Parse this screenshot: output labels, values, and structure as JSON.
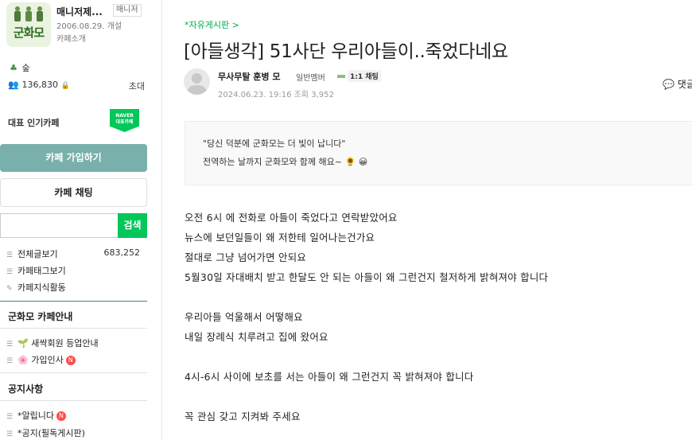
{
  "cafe": {
    "name": "매니저제...",
    "manager_badge": "매니저",
    "founded": "2006.08.29. 개설",
    "intro": "카페소개",
    "logo_text": "군화모",
    "level": "숲",
    "members": "136,830",
    "invite": "초대",
    "popular": "대표 인기카페",
    "naver_badge_top": "NAVER",
    "naver_badge_bottom": "대표카페"
  },
  "sidebar": {
    "join_label": "카페 가입하기",
    "chat_label": "카페 채팅",
    "search_placeholder": "",
    "search_label": "검색",
    "menu": [
      {
        "label": "전체글보기",
        "count": "683,252"
      },
      {
        "label": "카페태그보기"
      },
      {
        "label": "카페지식활동"
      }
    ],
    "section_guide": "군화모 카페안내",
    "guide_items": [
      {
        "label": "새싹회원 등업안내"
      },
      {
        "label": "가입인사"
      }
    ],
    "section_notice": "공지사항",
    "notice_items": [
      {
        "label": "*알립니다"
      },
      {
        "label": "*공지(필독게시판)"
      }
    ],
    "new_badge": "N"
  },
  "post": {
    "board": "*자유게시판 >",
    "title": "[아들생각] 51사단 우리아들이..죽었다네요",
    "author": "무사무탈 훈병 모",
    "member_level": "일반멤버",
    "chat_link": "1:1 채팅",
    "meta": "2024.06.23. 19:16   조회 3,952",
    "comment_link": "댓글",
    "quote_lines": [
      "\"당신 덕분에 군화모는 더 빛이 납니다\"",
      "전역하는 날까지 군화모와 함께 해요~ 🌻 😀"
    ],
    "body_lines": [
      "오전 6시 에 전화로    아들이  죽었다고  연락받았어요",
      "뉴스에  보던일들이  왜  저한테  일어나는건가요",
      "절대로  그냥  넘어가면  안되요",
      " 5월30일  자대배치  받고  한달도   안  되는  아들이  왜  그런건지  철저하게  밝혀져야  합니다",
      "우리아들  억울해서  어떻해요",
      "내일  장례식   치루려고  집에  왔어요",
      "4시-6시  사이에 보초를  서는  아들이  왜  그런건지  꼭  밝혀져야 합니다",
      "꼭  관심  갖고    지켜봐  주세요"
    ]
  },
  "colors": {
    "accent_green": "#03c75a",
    "join_button": "#79b0ac",
    "section_line": "#2f8f6a",
    "new_badge": "#ff4b4b"
  }
}
